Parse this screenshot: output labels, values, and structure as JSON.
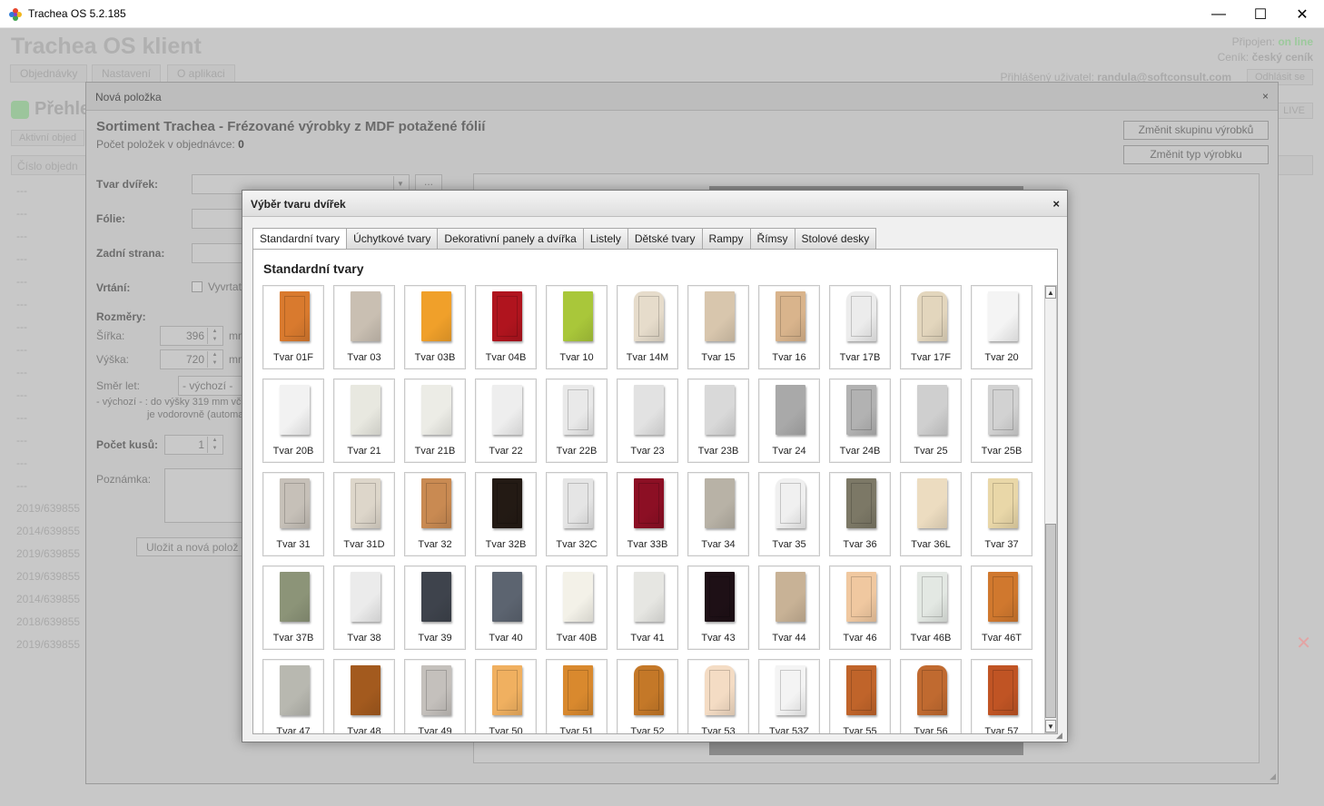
{
  "window": {
    "title": "Trachea OS 5.2.185",
    "min": "—",
    "max": "☐",
    "close": "✕"
  },
  "app": {
    "title": "Trachea OS klient",
    "tabs": [
      "Objednávky",
      "Nastavení",
      "O aplikaci"
    ],
    "status": {
      "connected_label": "Připojen:",
      "connected_value": "on line",
      "pricelist_label": "Ceník:",
      "pricelist_value": "český ceník",
      "user_label": "Přihlášený uživatel:",
      "user_value": "randula@softconsult.com",
      "logout": "Odhlásit se"
    },
    "overview_title": "Přehle",
    "active_btn": "Aktivní objed",
    "column_header": "Číslo objedn",
    "live_btn": "LIVE",
    "rows": [
      "---",
      "---",
      "---",
      "---",
      "---",
      "---",
      "---",
      "---",
      "---",
      "---",
      "---",
      "---",
      "---",
      "---",
      "2019/639855",
      "2014/639855",
      "2019/639855",
      "2019/639855",
      "2014/639855",
      "2018/639855",
      "2019/639855"
    ]
  },
  "new_item_dialog": {
    "title": "Nová položka",
    "close": "×",
    "heading": "Sortiment Trachea - Frézované výrobky z MDF potažené fólií",
    "count_label": "Počet položek v objednávce:",
    "count_value": "0",
    "btn_change_group": "Změnit skupinu výrobků",
    "btn_change_type": "Změnit typ výrobku",
    "labels": {
      "door_shape": "Tvar dvířek:",
      "foil": "Fólie:",
      "back": "Zadní strana:",
      "drilling": "Vrtání:",
      "drill_option": "Vyvrtat",
      "dimensions": "Rozměry:",
      "width": "Šířka:",
      "height": "Výška:",
      "grain": "Směr let:",
      "pieces": "Počet kusů:",
      "note": "Poznámka:"
    },
    "browse_btn": "...",
    "width_value": "396",
    "height_value": "720",
    "unit": "mm",
    "grain_value": "- výchozí -",
    "grain_note_1": "- výchozí - : do výšky 319 mm vč",
    "grain_note_2": "je vodorovně (automa",
    "pieces_value": "1",
    "save_btn": "Uložit a nová polož"
  },
  "shape_dialog": {
    "title": "Výběr tvaru dvířek",
    "close": "×",
    "tabs": [
      "Standardní tvary",
      "Úchytkové tvary",
      "Dekorativní panely a dvířka",
      "Listely",
      "Dětské tvary",
      "Rampy",
      "Římsy",
      "Stolové desky"
    ],
    "active_tab": "Standardní tvary",
    "section_title": "Standardní tvary",
    "items": [
      {
        "name": "Tvar 01F",
        "color": "#d97a2e",
        "style": "ornate"
      },
      {
        "name": "Tvar 03",
        "color": "#c9bfb2",
        "style": "plain"
      },
      {
        "name": "Tvar 03B",
        "color": "#f0a02a",
        "style": "plain"
      },
      {
        "name": "Tvar 04B",
        "color": "#b0141e",
        "style": "panel"
      },
      {
        "name": "Tvar 10",
        "color": "#a9c73a",
        "style": "plain"
      },
      {
        "name": "Tvar 14M",
        "color": "#e6dccb",
        "style": "arch"
      },
      {
        "name": "Tvar 15",
        "color": "#d8c6ad",
        "style": "plain"
      },
      {
        "name": "Tvar 16",
        "color": "#d9b48c",
        "style": "panel"
      },
      {
        "name": "Tvar 17B",
        "color": "#ececec",
        "style": "arch"
      },
      {
        "name": "Tvar 17F",
        "color": "#e3d6bd",
        "style": "arch"
      },
      {
        "name": "Tvar 20",
        "color": "#f4f4f4",
        "style": "plain"
      },
      {
        "name": "Tvar 20B",
        "color": "#f2f2f2",
        "style": "plain"
      },
      {
        "name": "Tvar 21",
        "color": "#e8e8e0",
        "style": "plain"
      },
      {
        "name": "Tvar 21B",
        "color": "#ecece6",
        "style": "plain"
      },
      {
        "name": "Tvar 22",
        "color": "#eeeeee",
        "style": "plain"
      },
      {
        "name": "Tvar 22B",
        "color": "#e9e9e9",
        "style": "panel"
      },
      {
        "name": "Tvar 23",
        "color": "#e2e2e2",
        "style": "plain"
      },
      {
        "name": "Tvar 23B",
        "color": "#d9d9d9",
        "style": "plain"
      },
      {
        "name": "Tvar 24",
        "color": "#a9a9a9",
        "style": "plain"
      },
      {
        "name": "Tvar 24B",
        "color": "#b2b2b2",
        "style": "panel"
      },
      {
        "name": "Tvar 25",
        "color": "#cfcfcf",
        "style": "plain"
      },
      {
        "name": "Tvar 25B",
        "color": "#d2d2d2",
        "style": "panel"
      },
      {
        "name": "Tvar 31",
        "color": "#c6c0b8",
        "style": "panel"
      },
      {
        "name": "Tvar 31D",
        "color": "#ddd6ca",
        "style": "panel"
      },
      {
        "name": "Tvar 32",
        "color": "#c98a52",
        "style": "panel"
      },
      {
        "name": "Tvar 32B",
        "color": "#231a14",
        "style": "panel"
      },
      {
        "name": "Tvar 32C",
        "color": "#e5e5e5",
        "style": "panel"
      },
      {
        "name": "Tvar 33B",
        "color": "#8c0f24",
        "style": "panel"
      },
      {
        "name": "Tvar 34",
        "color": "#b8b2a6",
        "style": "plain"
      },
      {
        "name": "Tvar 35",
        "color": "#f0f0f0",
        "style": "arch"
      },
      {
        "name": "Tvar 36",
        "color": "#7c7866",
        "style": "panel"
      },
      {
        "name": "Tvar 36L",
        "color": "#ecdcc0",
        "style": "plain"
      },
      {
        "name": "Tvar 37",
        "color": "#e9d7a8",
        "style": "panel"
      },
      {
        "name": "Tvar 37B",
        "color": "#8c9478",
        "style": "plain"
      },
      {
        "name": "Tvar 38",
        "color": "#ebebeb",
        "style": "plain"
      },
      {
        "name": "Tvar 39",
        "color": "#3e434c",
        "style": "plain"
      },
      {
        "name": "Tvar 40",
        "color": "#5c6470",
        "style": "plain"
      },
      {
        "name": "Tvar 40B",
        "color": "#f3f1e8",
        "style": "plain"
      },
      {
        "name": "Tvar 41",
        "color": "#e6e6e2",
        "style": "plain"
      },
      {
        "name": "Tvar 43",
        "color": "#1e1016",
        "style": "panel"
      },
      {
        "name": "Tvar 44",
        "color": "#c8b296",
        "style": "plain"
      },
      {
        "name": "Tvar 46",
        "color": "#f0c8a0",
        "style": "panel"
      },
      {
        "name": "Tvar 46B",
        "color": "#e3e8e3",
        "style": "panel"
      },
      {
        "name": "Tvar 46T",
        "color": "#d0782e",
        "style": "panel"
      },
      {
        "name": "Tvar 47",
        "color": "#b8b8b0",
        "style": "plain"
      },
      {
        "name": "Tvar 48",
        "color": "#a35a1e",
        "style": "plain"
      },
      {
        "name": "Tvar 49",
        "color": "#c4c0bc",
        "style": "panel"
      },
      {
        "name": "Tvar 50",
        "color": "#f0b060",
        "style": "panel"
      },
      {
        "name": "Tvar 51",
        "color": "#d9892e",
        "style": "panel"
      },
      {
        "name": "Tvar 52",
        "color": "#c47828",
        "style": "arch"
      },
      {
        "name": "Tvar 53",
        "color": "#f4dcc4",
        "style": "arch"
      },
      {
        "name": "Tvar 53Z",
        "color": "#f4f4f4",
        "style": "panel"
      },
      {
        "name": "Tvar 55",
        "color": "#c0642a",
        "style": "panel"
      },
      {
        "name": "Tvar 56",
        "color": "#c06a30",
        "style": "arch"
      },
      {
        "name": "Tvar 57",
        "color": "#c05424",
        "style": "panel"
      }
    ]
  }
}
